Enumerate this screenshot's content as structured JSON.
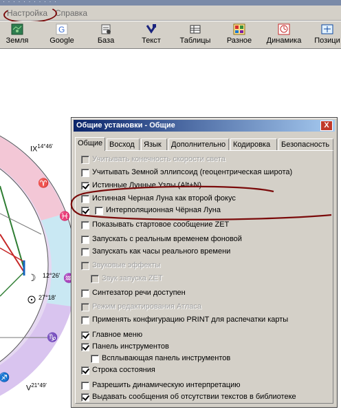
{
  "menu": {
    "items": [
      "Настройка",
      "Справка"
    ]
  },
  "toolbar": {
    "buttons": [
      {
        "label": "Земля",
        "icon": "earth-icon"
      },
      {
        "label": "Google",
        "icon": "google-icon"
      },
      {
        "label": "База",
        "icon": "database-icon"
      },
      {
        "label": "Текст",
        "icon": "text-icon"
      },
      {
        "label": "Таблицы",
        "icon": "tables-icon"
      },
      {
        "label": "Разное",
        "icon": "misc-icon"
      },
      {
        "label": "Динамика",
        "icon": "dynamics-icon"
      },
      {
        "label": "Позици",
        "icon": "positions-icon"
      }
    ]
  },
  "chart": {
    "deg1": "IX",
    "deg1_sup": "14°46'",
    "deg2": "12°26'",
    "deg3": "27°18'",
    "deg4": "V",
    "deg4_sup": "21°49'"
  },
  "dialog": {
    "title": "Общие установки - Общие",
    "close_label": "X",
    "tabs": [
      "Общие",
      "Восход",
      "Язык",
      "Дополнительно",
      "Кодировка",
      "Безопасность"
    ],
    "active_tab": "Общие",
    "options": [
      {
        "label": "Учитывать конечность скорости света",
        "checked": false,
        "enabled": false
      },
      {
        "label": "Учитывать Земной эллипсоид (геоцентрическая широта)",
        "checked": false,
        "enabled": true
      },
      {
        "label": "Истинные Лунные Узлы (Alt+N)",
        "checked": true,
        "enabled": true
      },
      {
        "label": "Истинная Черная Луна как второй фокус",
        "checked": false,
        "enabled": true
      },
      {
        "label": "Интерполяционная Чёрная Луна",
        "checked": false,
        "enabled": true
      },
      {
        "label": "Показывать стартовое сообщение ZET",
        "checked": false,
        "enabled": true
      },
      {
        "label": "Запускать с реальным временем фоновой",
        "checked": false,
        "enabled": true
      },
      {
        "label": "Запускать как часы реального времени",
        "checked": false,
        "enabled": true
      },
      {
        "label": "Звуковые эффекты",
        "checked": false,
        "enabled": false
      },
      {
        "label": "Звук запуска ZET",
        "checked": false,
        "enabled": false
      },
      {
        "label": "Синтезатор речи доступен",
        "checked": false,
        "enabled": true
      },
      {
        "label": "Режим редактирования Атласа",
        "checked": false,
        "enabled": false
      },
      {
        "label": "Применять конфигурацию PRINT для распечатки карты",
        "checked": false,
        "enabled": true
      },
      {
        "label": "Главное меню",
        "checked": true,
        "enabled": true
      },
      {
        "label": "Панель инструментов",
        "checked": true,
        "enabled": true
      },
      {
        "label": "Всплывающая панель инструментов",
        "checked": false,
        "enabled": true
      },
      {
        "label": "Строка состояния",
        "checked": true,
        "enabled": true
      },
      {
        "label": "Разрешить динамическую интерпретацию",
        "checked": false,
        "enabled": true
      },
      {
        "label": "Выдавать сообщения об отсутствии текстов в библиотеке",
        "checked": true,
        "enabled": true
      }
    ],
    "extra_checkbox_row5_checked": true
  },
  "colors": {
    "annotation": "#7a0a0a",
    "title_start": "#0a246a",
    "title_end": "#a6caf0"
  }
}
